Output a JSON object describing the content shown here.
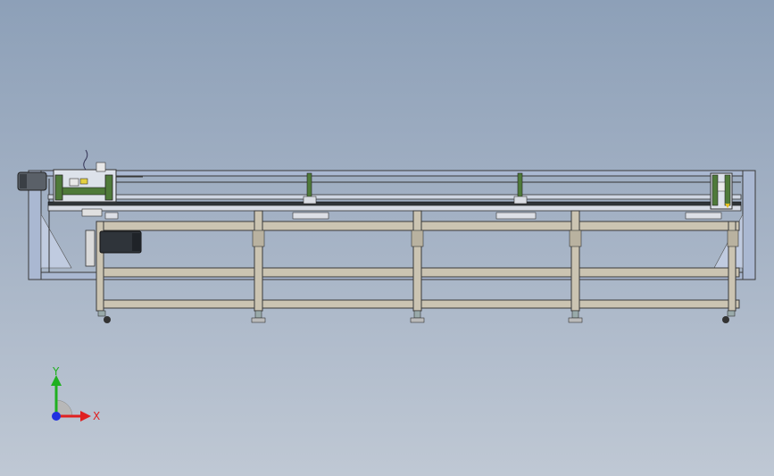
{
  "colors": {
    "background_top": "#8da0b8",
    "background_bottom": "#bfc8d4",
    "frame_fill": "#c9c1ae",
    "frame_stroke": "#3a3a3a",
    "outer_frame_fill": "#a9b6d0",
    "green_part": "#4f7a3a",
    "motor_dark": "#3a3f45",
    "axis_x": "#e02020",
    "axis_y": "#20b020",
    "axis_z": "#2030e0"
  },
  "triad": {
    "x_label": "X",
    "y_label": "Y",
    "x_icon": "arrow-right-icon",
    "y_icon": "arrow-up-icon",
    "origin_icon": "axis-origin-icon"
  }
}
